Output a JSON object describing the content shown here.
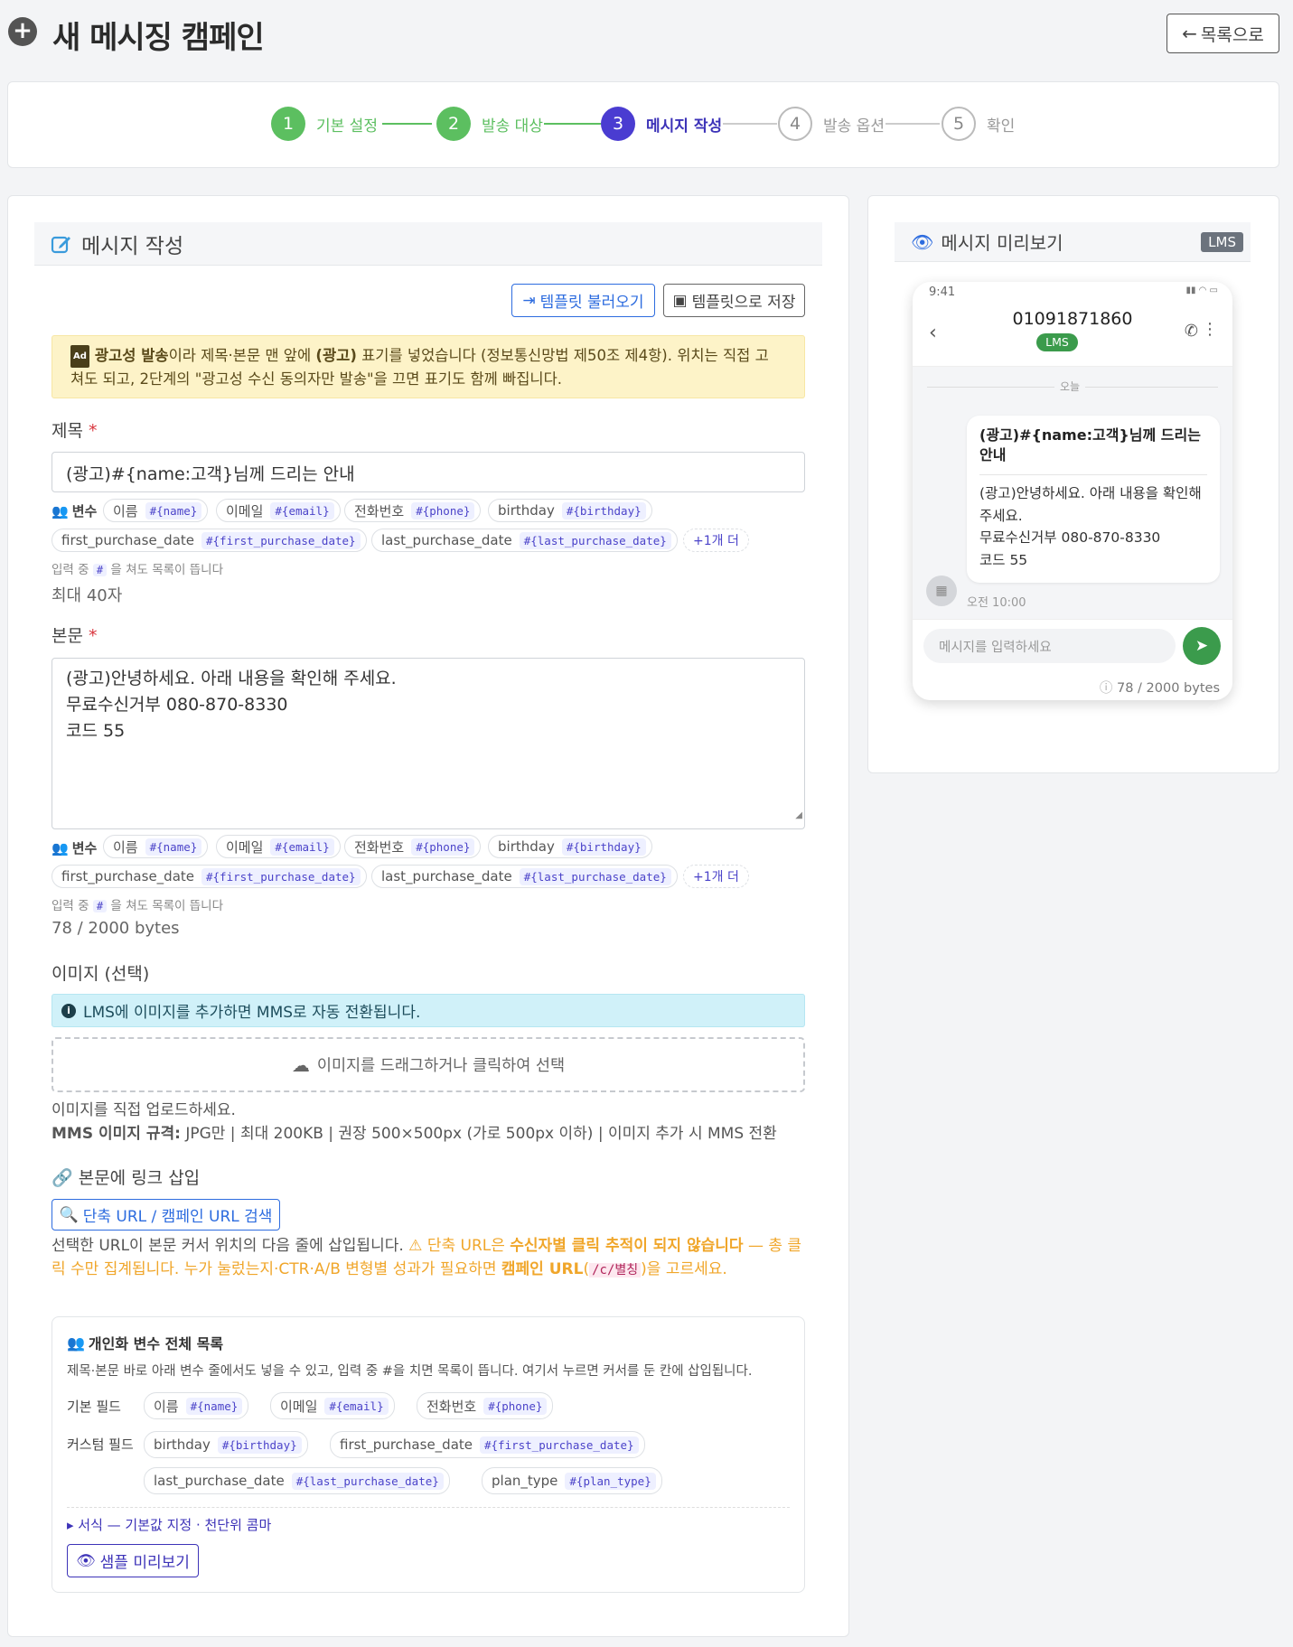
{
  "header": {
    "title": "새 메시징 캠페인",
    "back_label": "목록으로"
  },
  "stepper": [
    {
      "num": "1",
      "label": "기본 설정",
      "state": "done"
    },
    {
      "num": "2",
      "label": "발송 대상",
      "state": "done"
    },
    {
      "num": "3",
      "label": "메시지 작성",
      "state": "current"
    },
    {
      "num": "4",
      "label": "발송 옵션",
      "state": "todo"
    },
    {
      "num": "5",
      "label": "확인",
      "state": "todo"
    }
  ],
  "compose": {
    "title": "메시지 작성",
    "load_template": "템플릿 불러오기",
    "save_template": "템플릿으로 저장",
    "ad_notice": {
      "bold1": "광고성 발송",
      "t1": "이라 제목·본문 맨 앞에 ",
      "bold2": "(광고)",
      "t2": " 표기를 넣었습니다 (정보통신망법 제50조 제4항). 위치는 직접 고",
      "line2": "쳐도 되고, 2단계의 \"광고성 수신 동의자만 발송\"을 끄면 표기도 함께 빠집니다."
    },
    "subject_label": "제목",
    "subject_value": "(광고)#{name:고객}님께 드리는 안내",
    "subject_limit": "최대 40자",
    "body_label": "본문",
    "body_lines": [
      "(광고)안녕하세요. 아래 내용을 확인해 주세요.",
      "무료수신거부 080-870-8330",
      "코드 55"
    ],
    "body_bytes": "78 / 2000 bytes",
    "vars_label": "변수",
    "var_chips": [
      {
        "name": "이름",
        "code": "#{name}"
      },
      {
        "name": "이메일",
        "code": "#{email}"
      },
      {
        "name": "전화번호",
        "code": "#{phone}"
      },
      {
        "name": "birthday",
        "code": "#{birthday}"
      },
      {
        "name": "first_purchase_date",
        "code": "#{first_purchase_date}"
      },
      {
        "name": "last_purchase_date",
        "code": "#{last_purchase_date}"
      }
    ],
    "more_chip": "+1개 더",
    "hint_pre": "입력 중 ",
    "hint_code": "#",
    "hint_post": " 을 쳐도 목록이 뜹니다",
    "image_label": "이미지 (선택)",
    "image_info": "LMS에 이미지를 추가하면 MMS로 자동 전환됩니다.",
    "dropzone": "이미지를 드래그하거나 클릭하여 선택",
    "image_help": "이미지를 직접 업로드하세요.",
    "image_spec_bold": "MMS 이미지 규격:",
    "image_spec": " JPG만 | 최대 200KB | 권장 500×500px (가로 500px 이하) | 이미지 추가 시 MMS 전환",
    "link_label": "본문에 링크 삽입",
    "link_search": "단축 URL / 캠페인 URL 검색",
    "link_note1": "선택한 URL이 본문 커서 위치의 다음 줄에 삽입됩니다.",
    "link_warn1": " 단축 URL은 ",
    "link_warn_bold": "수신자별 클릭 추적이 되지 않습니다",
    "link_warn2": " — 총 클",
    "link_warn3": "릭 수만 집계됩니다. 누가 눌렀는지·CTR·A/B 변형별 성과가 필요하면 ",
    "link_warn_bold2": "캠페인 URL",
    "link_warn4": "(",
    "link_warn_code": "/c/별칭",
    "link_warn5": ")을 고르세요."
  },
  "var_panel": {
    "title": "개인화 변수 전체 목록",
    "desc": "제목·본문 바로 아래 변수 줄에서도 넣을 수 있고, 입력 중 #을 치면 목록이 뜹니다. 여기서 누르면 커서를 둔 칸에 삽입됩니다.",
    "basic_label": "기본 필드",
    "basic": [
      {
        "name": "이름",
        "code": "#{name}"
      },
      {
        "name": "이메일",
        "code": "#{email}"
      },
      {
        "name": "전화번호",
        "code": "#{phone}"
      }
    ],
    "custom_label": "커스텀 필드",
    "custom": [
      {
        "name": "birthday",
        "code": "#{birthday}"
      },
      {
        "name": "first_purchase_date",
        "code": "#{first_purchase_date}"
      },
      {
        "name": "last_purchase_date",
        "code": "#{last_purchase_date}"
      },
      {
        "name": "plan_type",
        "code": "#{plan_type}"
      }
    ],
    "format_toggle": "▸ 서식 — 기본값 지정 · 천단위 콤마",
    "sample_btn": "샘플 미리보기"
  },
  "preview": {
    "title": "메시지 미리보기",
    "type_badge": "LMS",
    "time": "9:41",
    "phone_number": "01091871860",
    "lms_pill": "LMS",
    "date_divider": "오늘",
    "bubble_title": "(광고)#{name:고객}님께 드리는 안내",
    "bubble_lines": [
      "(광고)안녕하세요. 아래 내용을 확인해",
      "주세요.",
      "무료수신거부 080-870-8330",
      "코드 55"
    ],
    "bubble_time": "오전 10:00",
    "input_placeholder": "메시지를 입력하세요",
    "bytes": "78 / 2000 bytes"
  },
  "colors": {
    "accent": "#4a3cd1",
    "done": "#5cbf60",
    "primary": "#2d6cdf",
    "send": "#3b9b4c"
  }
}
